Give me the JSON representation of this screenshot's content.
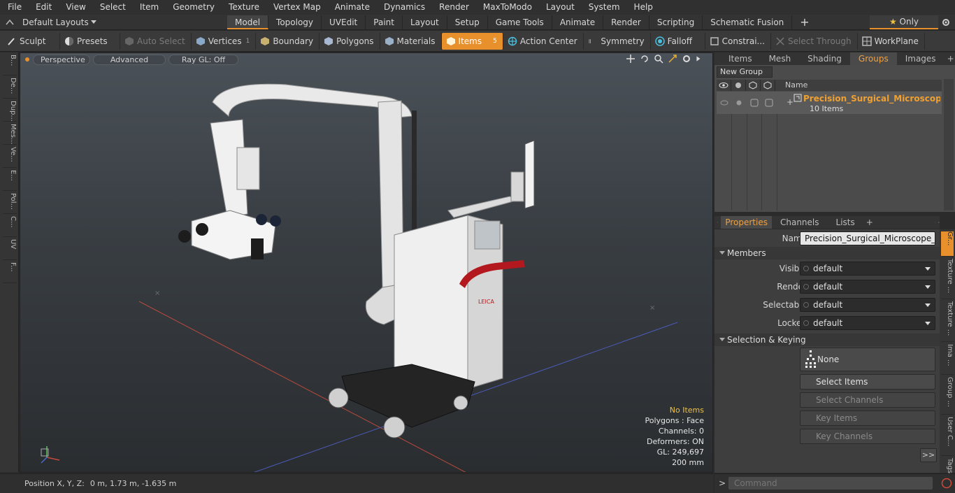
{
  "menu": [
    "File",
    "Edit",
    "View",
    "Select",
    "Item",
    "Geometry",
    "Texture",
    "Vertex Map",
    "Animate",
    "Dynamics",
    "Render",
    "MaxToModo",
    "Layout",
    "System",
    "Help"
  ],
  "layout_bar": {
    "layouts_label": "Default Layouts",
    "tabs": [
      "Model",
      "Topology",
      "UVEdit",
      "Paint",
      "Layout",
      "Setup",
      "Game Tools",
      "Animate",
      "Render",
      "Scripting",
      "Schematic Fusion"
    ],
    "add_label": "+",
    "only_label": "Only"
  },
  "toolbar": {
    "sculpt": "Sculpt",
    "presets": "Presets",
    "auto_select": "Auto Select",
    "vertices": "Vertices",
    "vertices_count": "1",
    "boundary": "Boundary",
    "polygons": "Polygons",
    "materials": "Materials",
    "items": "Items",
    "items_count": "5",
    "action_center": "Action Center",
    "symmetry": "Symmetry",
    "falloff": "Falloff",
    "constraints": "Constrai...",
    "select_through": "Select Through",
    "workplane": "WorkPlane"
  },
  "left_strip": [
    "B...",
    "De...",
    "Dup...",
    "Mes...",
    "Ve...",
    "E...",
    "Pol...",
    "C...",
    "UV",
    "F..."
  ],
  "viewport": {
    "perspective": "Perspective",
    "advanced": "Advanced",
    "raygl": "Ray GL: Off",
    "brand_text": "LEICA",
    "info": {
      "no_items": "No Items",
      "polygons": "Polygons : Face",
      "channels": "Channels: 0",
      "deformers": "Deformers: ON",
      "gl": "GL: 249,697",
      "scale": "200 mm"
    }
  },
  "status": {
    "label": "Position X, Y, Z:",
    "value": "0 m, 1.73 m, -1.635 m"
  },
  "right_tabs": [
    "Items",
    "Mesh ...",
    "Shading",
    "Groups",
    "Images"
  ],
  "groups": {
    "new_group": "New Group",
    "name_header": "Name",
    "row_title": "Precision_Surgical_Microscope_...",
    "row_sub": "10 Items"
  },
  "prop_tabs": [
    "Properties",
    "Channels",
    "Lists"
  ],
  "properties": {
    "name_label": "Name",
    "name_value": "Precision_Surgical_Microscope_Leica_I",
    "members_header": "Members",
    "visible_label": "Visible",
    "render_label": "Render",
    "selectable_label": "Selectable",
    "locked_label": "Locked",
    "default_value": "default",
    "sel_keying_header": "Selection & Keying",
    "none_label": "None",
    "select_items": "Select Items",
    "select_channels": "Select Channels",
    "key_items": "Key Items",
    "key_channels": "Key Channels",
    "more": ">>"
  },
  "right_strip": [
    "Gr...",
    "Texture ...",
    "Texture ...",
    "Ima ...",
    "Group ...",
    "User C...",
    "Tags"
  ],
  "command": {
    "prompt": ">",
    "placeholder": "Command"
  }
}
